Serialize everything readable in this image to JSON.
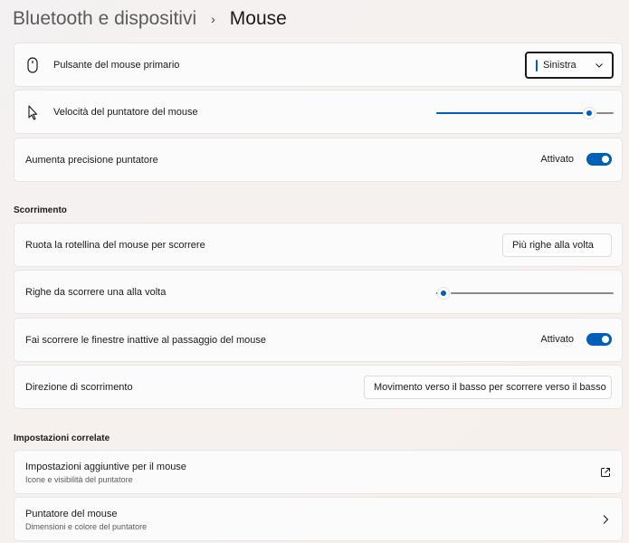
{
  "breadcrumb": {
    "parent": "Bluetooth e dispositivi",
    "separator": "›",
    "current": "Mouse"
  },
  "settings": {
    "primary_button": {
      "label": "Pulsante del mouse primario",
      "value": "Sinistra",
      "icon": "mouse-icon"
    },
    "pointer_speed": {
      "label": "Velocità del puntatore del mouse",
      "icon": "pointer-icon",
      "level": 0.86
    },
    "pointer_precision": {
      "label": "Aumenta precisione puntatore",
      "state": "Attivato"
    }
  },
  "scrolling": {
    "title": "Scorrimento",
    "wheel": {
      "label": "Ruota la rotellina del mouse per scorrere",
      "value": "Più righe alla volta"
    },
    "lines": {
      "label": "Righe da scorrere una alla volta",
      "level": 0.04
    },
    "inactive": {
      "label": "Fai scorrere le finestre inattive al passaggio del mouse",
      "state": "Attivato"
    },
    "direction": {
      "label": "Direzione di scorrimento",
      "value": "Movimento verso il basso per scorrere verso il basso"
    }
  },
  "related": {
    "title": "Impostazioni correlate",
    "additional": {
      "title": "Impostazioni aggiuntive per il mouse",
      "desc": "Icone e visibilità del puntatore",
      "icon": "external-link-icon"
    },
    "pointer": {
      "title": "Puntatore del mouse",
      "desc": "Dimensioni e colore del puntatore",
      "icon": "chevron-right-icon"
    }
  },
  "colors": {
    "accent": "#005fb8"
  }
}
